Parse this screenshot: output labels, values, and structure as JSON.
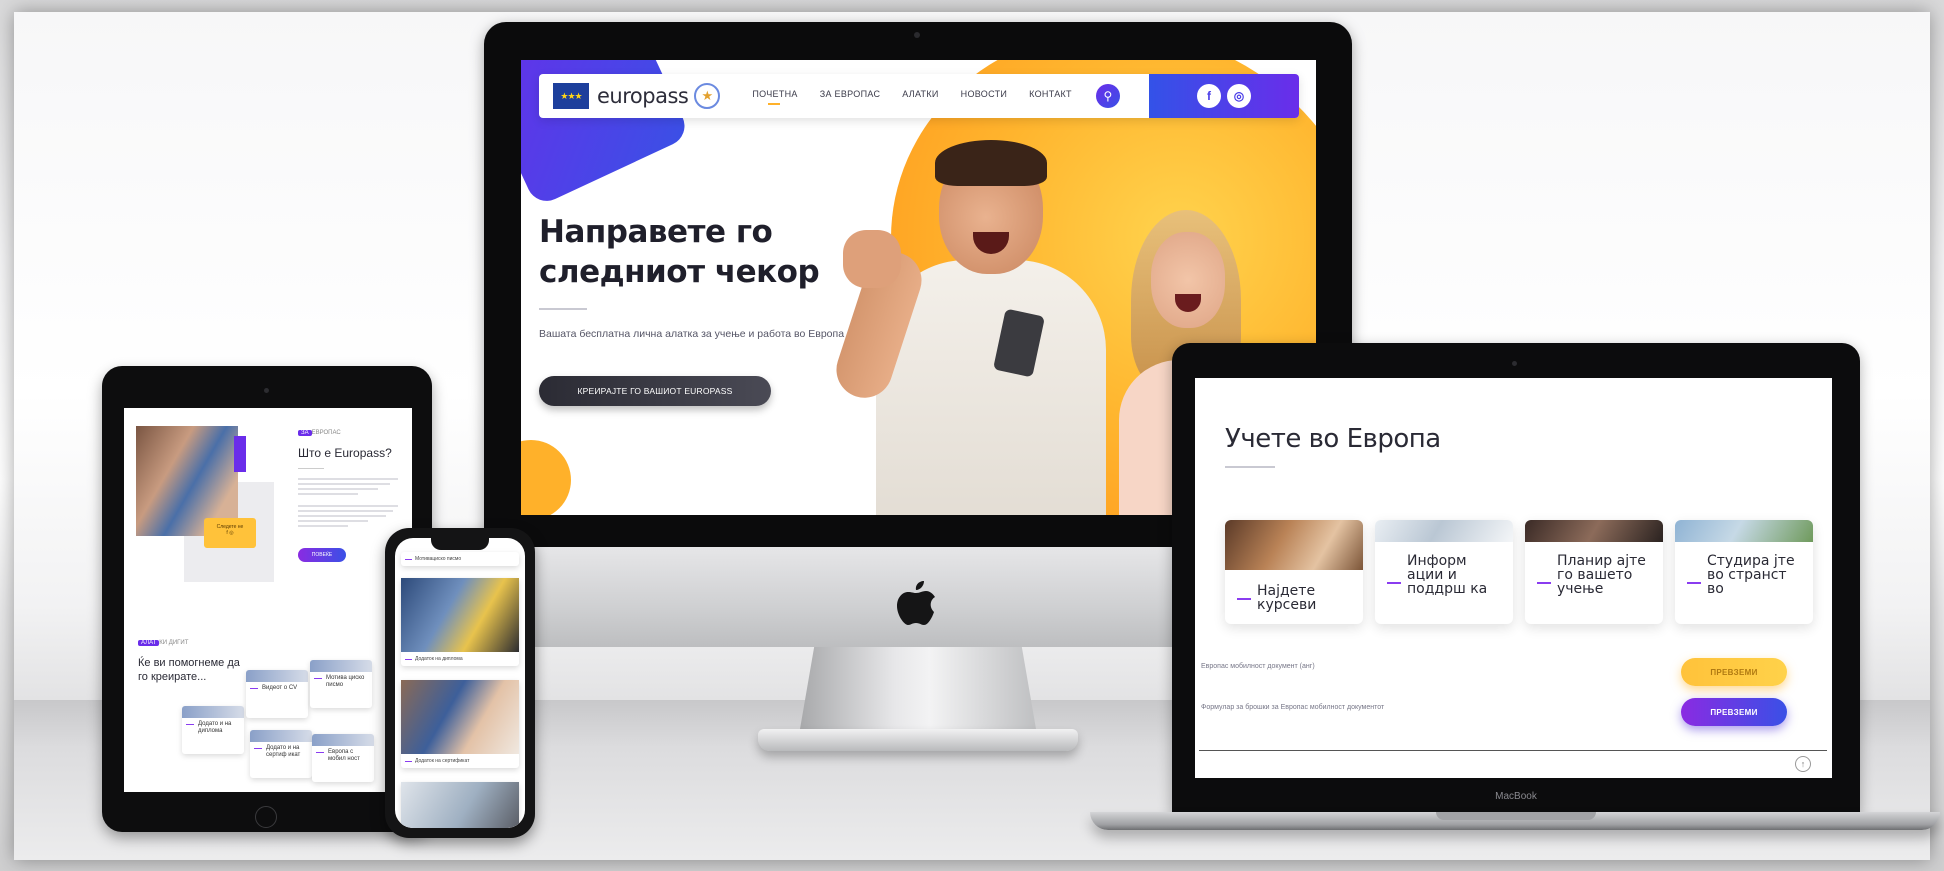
{
  "imac": {
    "nav": {
      "logo_text": "europass",
      "logo_star": "★",
      "eu_stars": "★★★",
      "menu": [
        {
          "label": "ПОЧЕТНА"
        },
        {
          "label": "ЗА ЕВРОПАС"
        },
        {
          "label": "АЛАТКИ"
        },
        {
          "label": "НОВОСТИ"
        },
        {
          "label": "КОНТАКТ"
        }
      ],
      "search_icon": "⚲",
      "social": [
        {
          "icon": "facebook-icon",
          "glyph": "f"
        },
        {
          "icon": "instagram-icon",
          "glyph": "◎"
        }
      ]
    },
    "hero": {
      "title": "Направете го следниот чекор",
      "subtitle": "Вашата бесплатна лична алатка за учење и работа во Европа",
      "cta": "КРЕИРАЈТЕ ГО ВАШИОТ EUROPASS"
    }
  },
  "macbook": {
    "title": "Учете во Европа",
    "cards": [
      {
        "label": "Најдете курсеви"
      },
      {
        "label": "Информ ации и поддрш ка"
      },
      {
        "label": "Планир ајте го вашето учење"
      },
      {
        "label": "Студира јте во странст во"
      }
    ],
    "downloads": [
      {
        "text": "Европас мобилност документ (анг)",
        "button": "ПРЕВЗЕМИ"
      },
      {
        "text": "Формулар за брошки за Европас мобилност документот",
        "button": "ПРЕВЗЕМИ"
      }
    ],
    "up_icon": "↑",
    "brand_label": "MacBook"
  },
  "ipad": {
    "tag_prefix": "ЗА",
    "tag": "ЕВРОПАС",
    "heading": "Што е Europass?",
    "badge_text": "Следете не",
    "badge_icons": "f ◎",
    "button": "ПОВЕЌЕ",
    "tag2_prefix": "АЛАТ",
    "tag2": "КИ ДИГИТ",
    "heading2": "Ќе ви помогнеме да го креирате...",
    "cards": [
      {
        "label": "Додато и на диплома"
      },
      {
        "label": "Видеот о CV"
      },
      {
        "label": "Додато и на сертиф икат"
      },
      {
        "label": "Мотива циско писмо"
      },
      {
        "label": "Европа с мобил ност"
      }
    ]
  },
  "iphone": {
    "items": [
      {
        "caption": "Мотивациско писмо"
      },
      {
        "caption": "Додаток на диплома"
      },
      {
        "caption": "Додаток на сертификат"
      }
    ]
  },
  "colors": {
    "accent_purple": "#6a2dea",
    "accent_blue": "#3a50e6",
    "accent_yellow": "#ffb52e"
  }
}
